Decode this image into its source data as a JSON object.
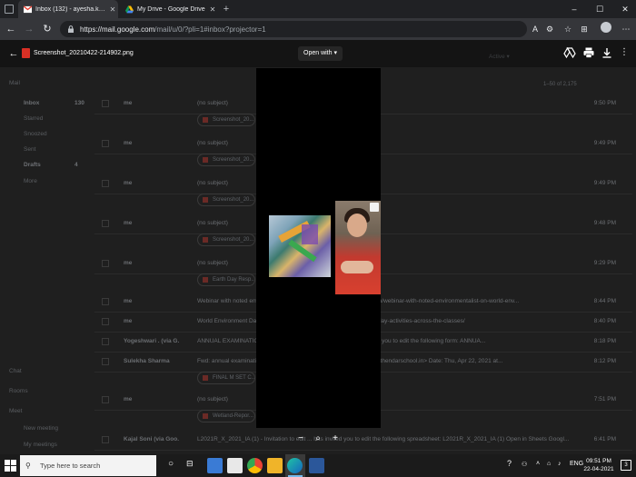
{
  "browser": {
    "tabs": [
      {
        "title": "Inbox (132) - ayesha.khan@then",
        "close": "✕",
        "favicon": "gmail-icon"
      },
      {
        "title": "My Drive - Google Drive",
        "close": "✕",
        "favicon": "google-drive-icon"
      }
    ],
    "new_tab": "+",
    "window_controls": {
      "minimize": "–",
      "maximize": "☐",
      "close": "✕"
    },
    "url_host": "https://mail.google.com",
    "url_path": "/mail/u/0/?pli=1#inbox?projector=1"
  },
  "viewer": {
    "file_name": "Screenshot_20210422-214902.png",
    "open_with": "Open with ▾",
    "zoom_out": "−",
    "zoom_in": "+",
    "zoom_icon": "⌕"
  },
  "gmail_background": {
    "nav": [
      {
        "label": "Mail",
        "bold": false
      },
      {
        "label": "Inbox",
        "bold": true,
        "count": "130"
      },
      {
        "label": "Starred",
        "bold": false
      },
      {
        "label": "Snoozed",
        "bold": false
      },
      {
        "label": "Sent",
        "bold": false
      },
      {
        "label": "Drafts",
        "bold": true,
        "count": "4"
      },
      {
        "label": "More",
        "bold": false
      },
      {
        "label": "Chat",
        "bold": false
      },
      {
        "label": "Rooms",
        "bold": false
      },
      {
        "label": "Meet",
        "bold": false
      },
      {
        "label": "New meeting",
        "bold": false
      },
      {
        "label": "My meetings",
        "bold": false
      }
    ],
    "page_range": "1–50 of 2,175",
    "active_label": "Active ▾",
    "rows": [
      {
        "sender": "me",
        "subject": "(no subject)",
        "time": "9:50 PM",
        "attachment": "Screenshot_20..."
      },
      {
        "sender": "me",
        "subject": "(no subject)",
        "time": "9:49 PM",
        "attachment": "Screenshot_20..."
      },
      {
        "sender": "me",
        "subject": "(no subject)",
        "time": "9:49 PM",
        "attachment": "Screenshot_20..."
      },
      {
        "sender": "me",
        "subject": "(no subject)",
        "time": "9:48 PM",
        "attachment": "Screenshot_20..."
      },
      {
        "sender": "me",
        "subject": "(no subject)",
        "time": "9:29 PM",
        "attachment": "Earth Day Resp..."
      },
      {
        "sender": "me",
        "subject": "Webinar with noted environmentalist ... School - http://thendarschool.in/webinar-with-noted-environmentalist-on-world-env...",
        "time": "8:44 PM",
        "attachment": ""
      },
      {
        "sender": "me",
        "subject": "World Environment Day ... http://thendarschool.in/world-environment-day-activities-across-the-classes/",
        "time": "8:40 PM",
        "attachment": ""
      },
      {
        "sender": "Yogeshwari . (via G.",
        "subject": "ANNUAL EXAMINATION ... yogeshwari@thendarschool.in has invited you to edit the following form: ANNUA...",
        "time": "8:18 PM",
        "attachment": ""
      },
      {
        "sender": "Sulekha Sharma",
        "subject": "Fwd: annual examination ... From: Archana Ramchandani <archana@thendarschool.in> Date: Thu, Apr 22, 2021 at...",
        "time": "8:12 PM",
        "attachment": "FINAL M SET C..."
      },
      {
        "sender": "me",
        "subject": "(no subject)",
        "time": "7:51 PM",
        "attachment": "Wetland-Repor..."
      },
      {
        "sender": "Kajal Soni (via Goo.",
        "subject": "L2021R_X_2021_IA (1) - Invitation to edit ... has invited you to edit the following spreadsheet: L2021R_X_2021_IA (1) Open in Sheets Googl...",
        "time": "6:41 PM",
        "attachment": ""
      }
    ]
  },
  "taskbar": {
    "search_placeholder": "Type here to search",
    "tray_lang": "ENG",
    "time": "09:51 PM",
    "date": "22-04-2021",
    "notification_count": "3"
  }
}
